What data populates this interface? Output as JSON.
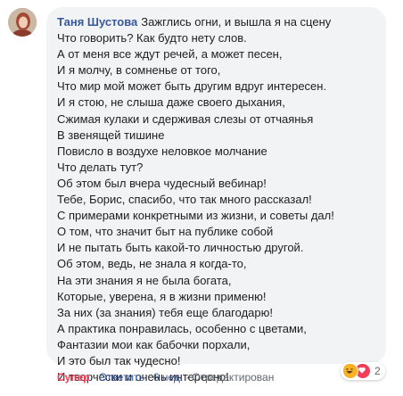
{
  "comment": {
    "author": "Таня Шустова",
    "lines": [
      "Зажглись огни, и вышла я на сцену",
      "Что говорить? Как будто нету слов.",
      "А от меня все ждут речей, а может песен,",
      "И я молчу, в сомненье от того,",
      "Что мир мой может быть другим вдруг интересен.",
      "И я стою, не слыша даже своего дыхания,",
      "Сжимая кулаки и сдерживая слезы от отчаянья",
      "В звенящей тишине",
      "Повисло в воздухе неловкое молчание",
      "Что делать тут?",
      "Об этом был вчера чудесный вебинар!",
      "Тебе, Борис, спасибо, что так много рассказал!",
      "С примерами конкретными из жизни, и советы дал!",
      "О том, что значит быт на публике собой",
      "И не пытать быть какой-то личностью другой.",
      "Об этом, ведь, не знала я когда-то,",
      "На эти знания я не была богата,",
      "Которые, уверена, я в жизни применю!",
      "За них (за знания) тебя еще благодарю!",
      "А практика понравилась, особенно с цветами,",
      "Фантазии мои как бабочки порхали,",
      "И это был так чудесно!",
      "И творчески и очень интересно!"
    ]
  },
  "reactions": {
    "icons": [
      "haha-icon",
      "love-icon"
    ],
    "count": "2"
  },
  "actions": {
    "like_label": "Супер",
    "reply_label": "Ответить",
    "time": "6 нед.",
    "edited": "Отредактирован",
    "separator": "·"
  },
  "colors": {
    "author": "#385898",
    "bubble": "#f2f3f5",
    "like": "#f33e58",
    "meta": "#606770"
  }
}
